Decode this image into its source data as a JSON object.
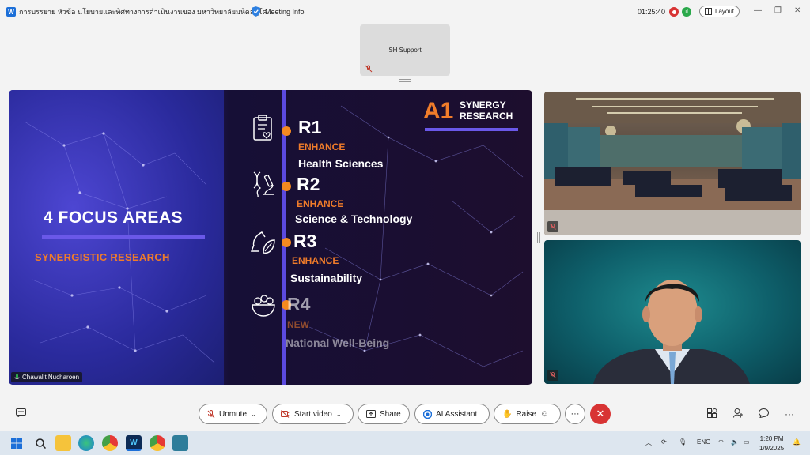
{
  "titlebar": {
    "window_title": "การบรรยาย หัวข้อ นโยบายและทิศทางการดำเนินงานของ มหาวิทยาลัยมหิดล (โค...",
    "meeting_info": "Meeting Info",
    "timer": "01:25:40",
    "layout_label": "Layout"
  },
  "top_participant": {
    "name": "SH Support"
  },
  "slide": {
    "main_title": "4 FOCUS AREAS",
    "main_subtitle": "SYNERGISTIC RESEARCH",
    "badge_code": "A1",
    "badge_line1": "SYNERGY",
    "badge_line2": "RESEARCH",
    "items": [
      {
        "code": "R1",
        "action": "ENHANCE",
        "desc": "Health Sciences"
      },
      {
        "code": "R2",
        "action": "ENHANCE",
        "desc": "Science & Technology"
      },
      {
        "code": "R3",
        "action": "ENHANCE",
        "desc": "Sustainability"
      },
      {
        "code": "R4",
        "action": "NEW",
        "desc": "National Well-Being"
      }
    ],
    "presenter_name": "Chawalit Nucharoen"
  },
  "controls": {
    "unmute": "Unmute",
    "start_video": "Start video",
    "share": "Share",
    "ai_assistant": "AI Assistant",
    "raise": "Raise",
    "more": "···",
    "end": "✕"
  },
  "taskbar": {
    "lang": "ENG",
    "time": "1:20 PM",
    "date": "1/9/2025"
  },
  "colors": {
    "accent_orange": "#f07c2a",
    "accent_purple": "#5b4adf",
    "end_red": "#d83434"
  }
}
